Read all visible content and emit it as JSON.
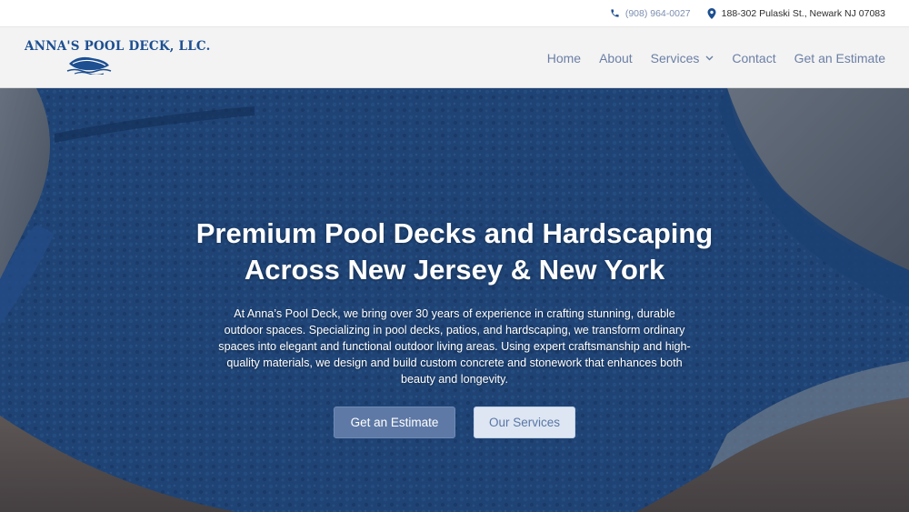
{
  "topbar": {
    "phone": "(908) 964-0027",
    "address": "188-302 Pulaski St., Newark NJ 07083",
    "phone_icon": "phone-icon",
    "address_icon": "map-pin-icon"
  },
  "header": {
    "logo_text": "ANNA'S POOL DECK, LLC.",
    "nav": {
      "home": "Home",
      "about": "About",
      "services": "Services",
      "contact": "Contact",
      "estimate": "Get an Estimate"
    }
  },
  "hero": {
    "title_line1": "Premium Pool Decks and Hardscaping",
    "title_line2": "Across New Jersey & New York",
    "description": "At Anna’s Pool Deck, we bring over 30 years of experience in crafting stunning, durable outdoor spaces. Specializing in pool decks, patios, and hardscaping, we transform ordinary spaces into elegant and functional outdoor living areas. Using expert craftsmanship and high-quality materials, we design and build custom concrete and stonework that enhances both beauty and longevity.",
    "primary_button": "Get an Estimate",
    "secondary_button": "Our Services"
  },
  "colors": {
    "brand_blue": "#1d4f91",
    "nav_text": "#6b7fa6",
    "button_primary": "#5e79a6",
    "button_secondary": "#dde6f2"
  }
}
